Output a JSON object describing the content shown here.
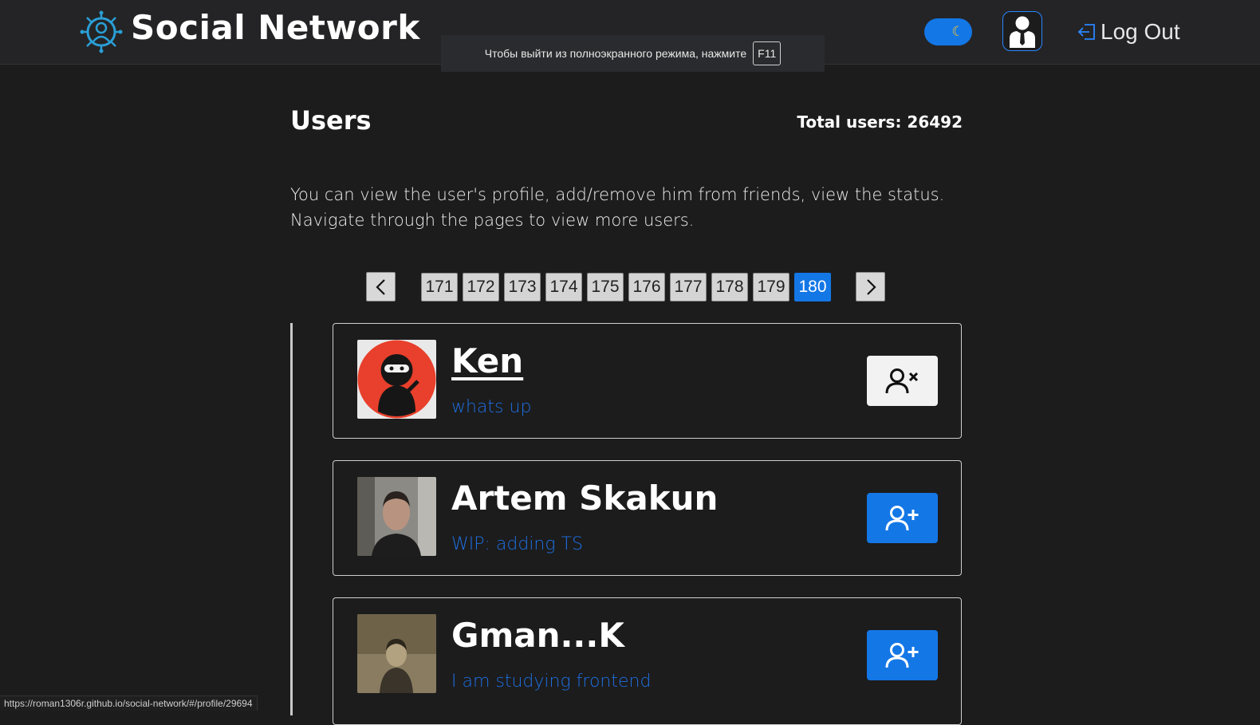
{
  "header": {
    "app_title": "Social Network",
    "logo_icon": "network-logo-icon",
    "theme_toggle": {
      "state": "dark",
      "icon": "moon-icon"
    },
    "profile_button_icon": "user-profile-icon",
    "logout": {
      "icon": "logout-icon",
      "label": "Log Out"
    }
  },
  "fullscreen_toast": {
    "message": "Чтобы выйти из полноэкранного режима, нажмите",
    "key": "F11"
  },
  "main": {
    "title": "Users",
    "total_label": "Total users: 26492",
    "intro_line1": "You can view the user's profile, add/remove him from friends, view the status.",
    "intro_line2": "Navigate through the pages to view more users."
  },
  "pagination": {
    "prev_icon": "chevron-left-icon",
    "next_icon": "chevron-right-icon",
    "pages": [
      "171",
      "172",
      "173",
      "174",
      "175",
      "176",
      "177",
      "178",
      "179",
      "180"
    ],
    "current": "180"
  },
  "users": [
    {
      "name": "Ken",
      "status": "whats up",
      "followed": true,
      "action_icon": "remove-friend-icon"
    },
    {
      "name": "Artem Skakun",
      "status": "WIP: adding TS",
      "followed": false,
      "action_icon": "add-friend-icon"
    },
    {
      "name": "Gman...K",
      "status": "I am studying frontend",
      "followed": false,
      "action_icon": "add-friend-icon"
    }
  ],
  "colors": {
    "background": "#1c1c1d",
    "header": "#242426",
    "accent": "#1477e6",
    "status_text": "#1e6fe0"
  },
  "status_bar_url": "https://roman1306r.github.io/social-network/#/profile/29694"
}
